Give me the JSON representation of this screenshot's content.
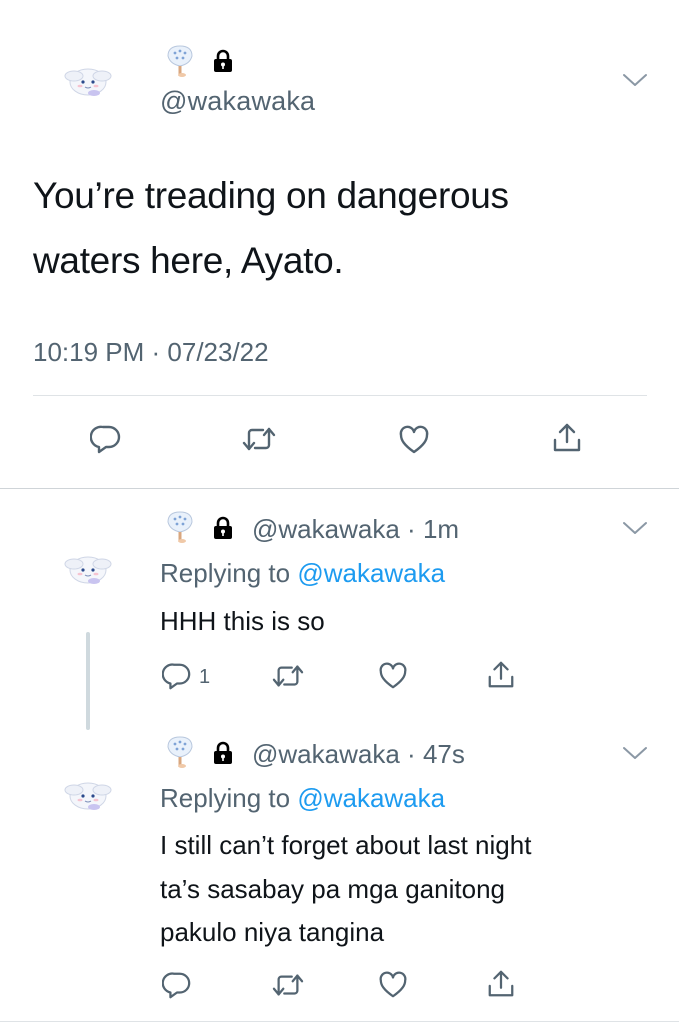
{
  "main_tweet": {
    "handle": "@wakawaka",
    "text_line1": "You’re treading on dangerous",
    "text_line2": "waters here, Ayato.",
    "timestamp": "10:19 PM · 07/23/22",
    "actions": [
      "reply-icon",
      "retweet-icon",
      "like-icon",
      "share-icon"
    ]
  },
  "replies": [
    {
      "handle": "@wakawaka",
      "separator": "·",
      "time": "1m",
      "replying_prefix": "Replying to",
      "replying_to": "@wakawaka",
      "text_lines": [
        "HHH this is so"
      ],
      "reply_count": "1"
    },
    {
      "handle": "@wakawaka",
      "separator": "·",
      "time": "47s",
      "replying_prefix": "Replying to",
      "replying_to": "@wakawaka",
      "text_lines": [
        "I still can’t forget about last night",
        "ta’s sasabay pa mga ganitong",
        "pakulo niya tangina"
      ],
      "reply_count": ""
    }
  ],
  "colors": {
    "accent": "#1d9bf0",
    "secondary_text": "#536471",
    "primary_text": "#0f1419"
  }
}
